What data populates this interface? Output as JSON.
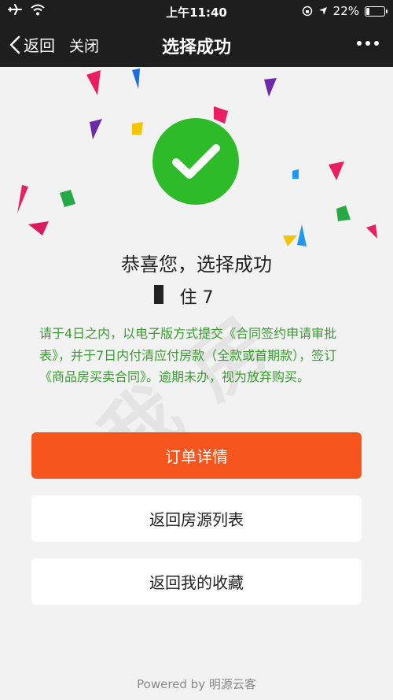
{
  "status_bar": {
    "time": "上午11:40",
    "battery_text": "22%",
    "battery_level": 0.22,
    "icons": [
      "airplane-icon",
      "wifi-icon",
      "rotation-lock-icon",
      "location-icon",
      "battery-icon"
    ]
  },
  "nav": {
    "back_label": "返回",
    "close_label": "关闭",
    "title": "选择成功",
    "more_icon": "more-icon"
  },
  "content": {
    "headline": "恭喜您，选择成功",
    "subject_text": "住          7",
    "notice": "请于4日之内，以电子版方式提交《合同签约申请审批表》，并于7日内付清应付房款（全款或首期款），签订《商品房买卖合同》。逾期未办，视为放弃购买。",
    "notice_color": "#3a9a32",
    "success_color": "#2dbb29"
  },
  "buttons": {
    "order_details": "订单详情",
    "back_to_listings": "返回房源列表",
    "back_to_favorites": "返回我的收藏",
    "primary_color": "#f6561d"
  },
  "footer": {
    "powered_by": "Powered by 明源云客"
  }
}
